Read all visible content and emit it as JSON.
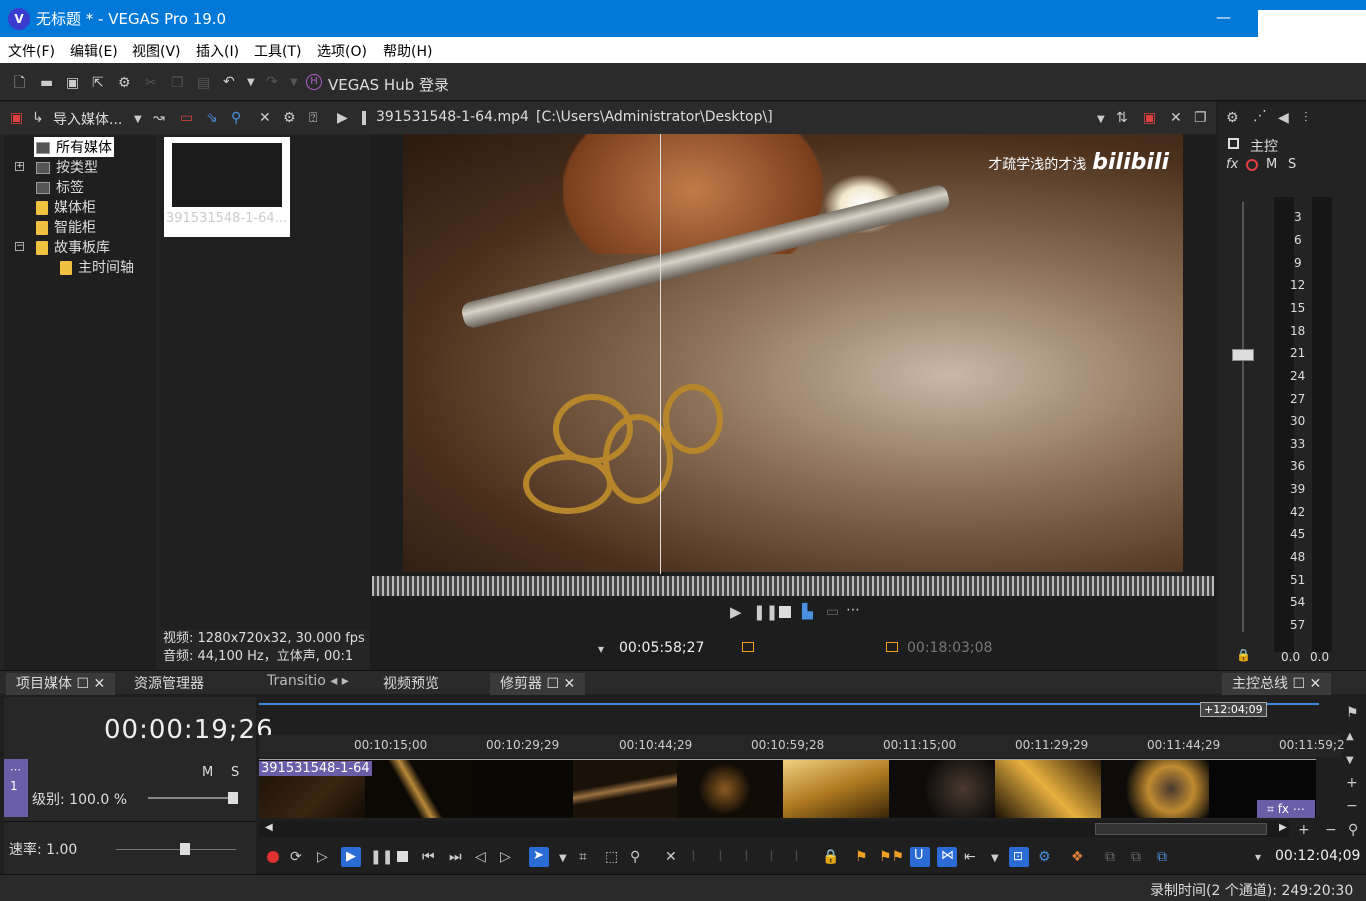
{
  "window": {
    "title": "无标题 * - VEGAS Pro 19.0",
    "logo": "V",
    "min": "—",
    "max": "☐",
    "close": "✕"
  },
  "menu": [
    "文件(F)",
    "编辑(E)",
    "视图(V)",
    "插入(I)",
    "工具(T)",
    "选项(O)",
    "帮助(H)"
  ],
  "toolbar": {
    "hub_label": "VEGAS Hub 登录"
  },
  "media_panel": {
    "import_label": "导入媒体...",
    "tree": [
      "所有媒体",
      "按类型",
      "标签",
      "媒体柜",
      "智能柜",
      "故事板库",
      "主时间轴"
    ],
    "thumb_caption": "391531548-1-64...",
    "info_video": "视频: 1280x720x32, 30.000 fps",
    "info_audio": "音频: 44,100 Hz，立体声, 00:1"
  },
  "trimmer": {
    "filename": "391531548-1-64.mp4",
    "path": "[C:\\Users\\Administrator\\Desktop\\]",
    "time_in": "00:05:58;27",
    "time_end": "00:18:03;08"
  },
  "preview": {
    "watermark_text": "才疏学浅的才浅",
    "watermark_brand": "bilibili"
  },
  "master": {
    "title": "主控",
    "fx": "fx",
    "m": "M",
    "s": "S",
    "scale": [
      "3",
      "6",
      "9",
      "12",
      "15",
      "18",
      "21",
      "24",
      "27",
      "30",
      "33",
      "36",
      "39",
      "42",
      "45",
      "48",
      "51",
      "54",
      "57"
    ],
    "left_val": "0.0",
    "right_val": "0.0"
  },
  "tabs": {
    "project_media": "项目媒体",
    "explorer": "资源管理器",
    "transitions": "Transitio",
    "video_preview": "视频预览",
    "trimmer": "修剪器",
    "master_bus": "主控总线"
  },
  "timeline": {
    "timecode": "00:00:19;26",
    "region_time": "+12:04;09",
    "track_number": "1",
    "m": "M",
    "s": "S",
    "level": "级别: 100.0 %",
    "rate": "速率: 1.00",
    "event_name": "391531548-1-64",
    "ticks": [
      "00:10:15;00",
      "00:10:29;29",
      "00:10:44;29",
      "00:10:59;28",
      "00:11:15;00",
      "00:11:29;29",
      "00:11:44;29",
      "00:11:59;2"
    ],
    "cursor_time": "00:12:04;09"
  },
  "status": {
    "text": "录制时间(2 个通道): 249:20:30"
  }
}
